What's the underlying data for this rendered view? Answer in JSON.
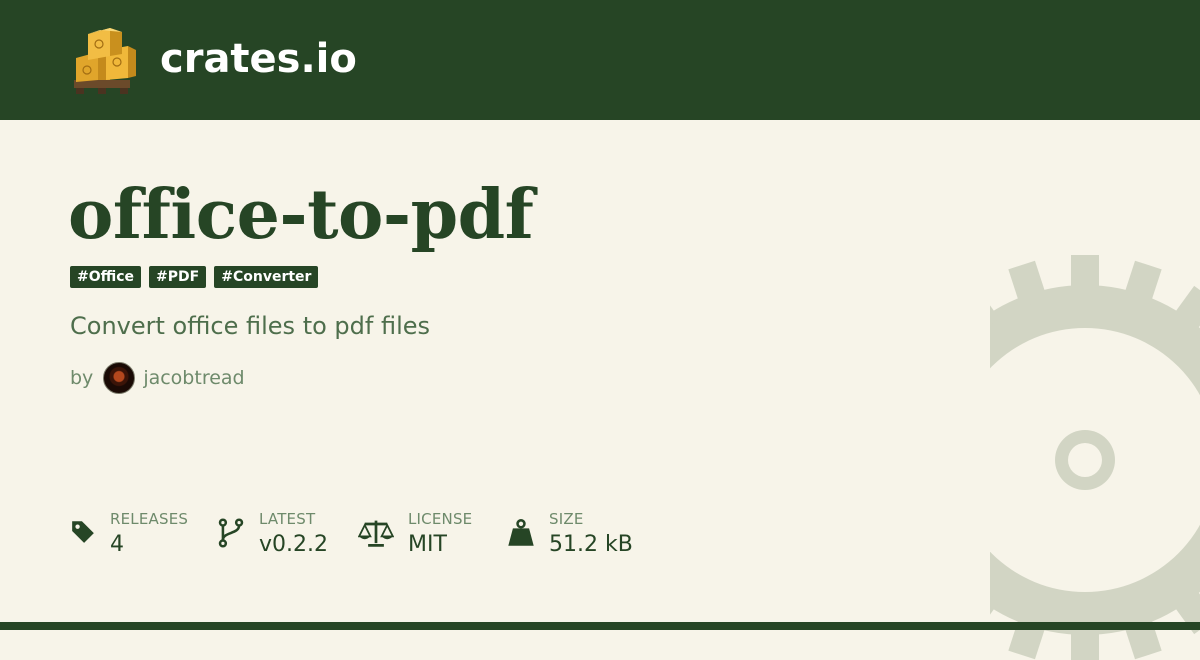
{
  "header": {
    "brand": "crates.io",
    "logo_icon": "crates-boxes-icon"
  },
  "crate": {
    "name": "office-to-pdf",
    "tags": [
      "#Office",
      "#PDF",
      "#Converter"
    ],
    "description": "Convert office files to pdf files",
    "by_label": "by",
    "author": "jacobtread"
  },
  "stats": [
    {
      "icon": "tag-icon",
      "label": "RELEASES",
      "value": "4"
    },
    {
      "icon": "branch-icon",
      "label": "LATEST",
      "value": "v0.2.2"
    },
    {
      "icon": "scale-icon",
      "label": "LICENSE",
      "value": "MIT"
    },
    {
      "icon": "weight-icon",
      "label": "SIZE",
      "value": "51.2 kB"
    }
  ],
  "colors": {
    "header_bg": "#264525",
    "page_bg": "#f7f4e9",
    "accent": "#264525"
  }
}
